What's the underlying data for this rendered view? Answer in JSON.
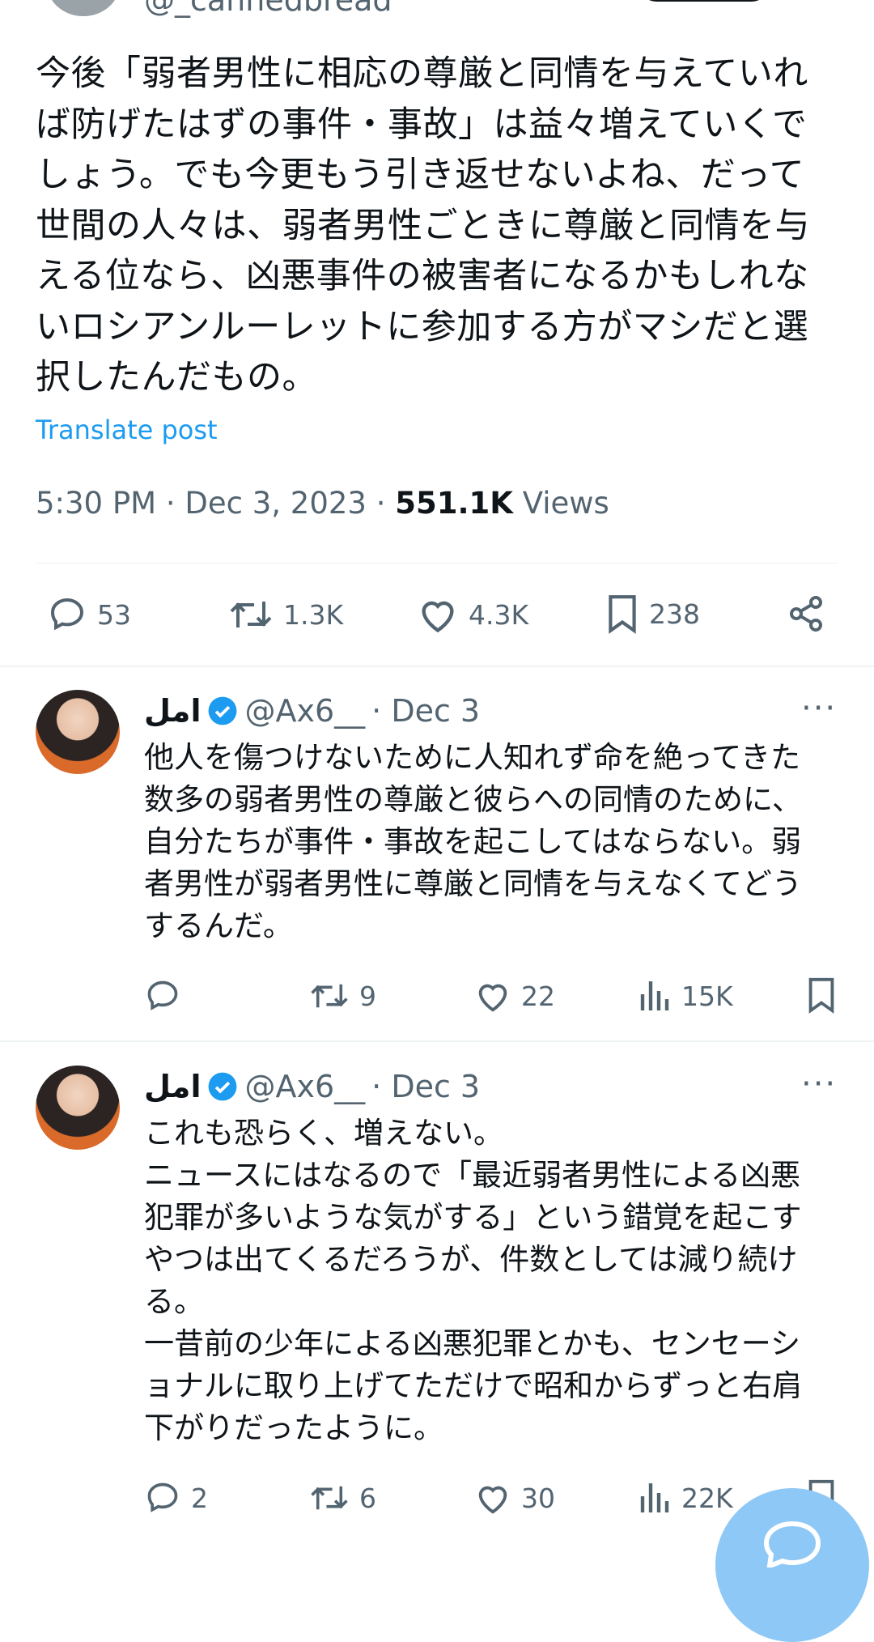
{
  "header": {
    "handle": "@_cannedbread"
  },
  "main_tweet": {
    "lines": [
      "今後「弱者男性に相応の尊厳と同情を与えていれ",
      "ば防げたはずの事件・事故」は益々増えていくで",
      "しょう。でも今更もう引き返せないよね、だって",
      "世間の人々は、弱者男性ごときに尊厳と同情を与",
      "える位なら、凶悪事件の被害者になるかもしれな",
      "いロシアンルーレットに参加する方がマシだと選",
      "択したんだもの。"
    ],
    "translate_label": "Translate post",
    "timestamp": "5:30 PM · Dec 3, 2023 · ",
    "views_count": "551.1K",
    "views_label": " Views",
    "actions": {
      "replies": "53",
      "reposts": "1.3K",
      "likes": "4.3K",
      "bookmarks": "238"
    }
  },
  "replies": [
    {
      "name": "امل",
      "handle": "@Ax6__",
      "date": "· Dec 3",
      "more": "···",
      "lines": [
        "他人を傷つけないために人知れず命を絶ってきた",
        "数多の弱者男性の尊厳と彼らへの同情のために、",
        "自分たちが事件・事故を起こしてはならない。弱",
        "者男性が弱者男性に尊厳と同情を与えなくてどう",
        "するんだ。"
      ],
      "actions": {
        "replies": "",
        "reposts": "9",
        "likes": "22",
        "views": "15K"
      }
    },
    {
      "name": "امل",
      "handle": "@Ax6__",
      "date": "· Dec 3",
      "more": "···",
      "lines": [
        "これも恐らく、増えない。",
        "ニュースにはなるので「最近弱者男性による凶悪",
        "犯罪が多いような気がする」という錯覚を起こす",
        "やつは出てくるだろうが、件数としては減り続け",
        "る。",
        "一昔前の少年による凶悪犯罪とかも、センセーシ",
        "ョナルに取り上げてただけで昭和からずっと右肩",
        "下がりだったように。"
      ],
      "actions": {
        "replies": "2",
        "reposts": "6",
        "likes": "30",
        "views": "22K"
      }
    }
  ],
  "colors": {
    "accent": "#1d9bf0",
    "text": "#0f1419",
    "muted": "#536471",
    "divider": "#eff3f4",
    "verified": "#1d9bf0",
    "fab": "#8ec8f6"
  }
}
